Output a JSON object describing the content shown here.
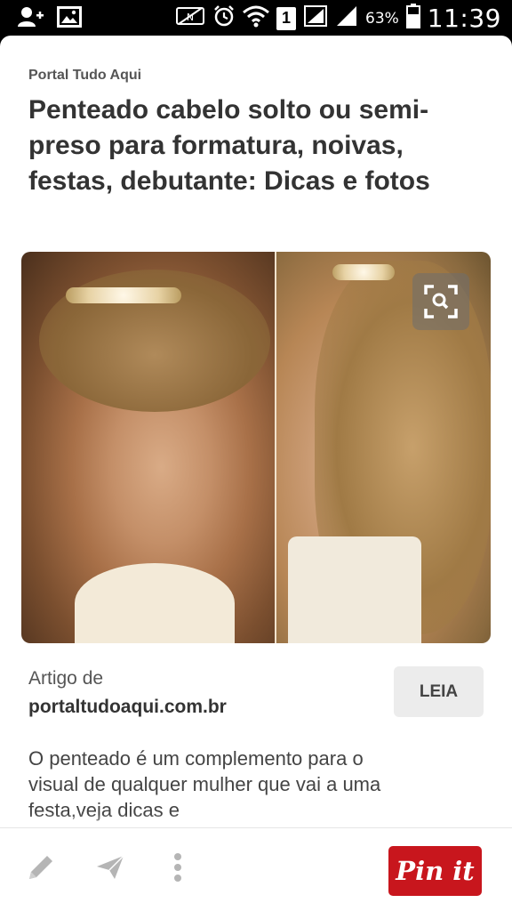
{
  "status_bar": {
    "battery_percent": "63%",
    "time": "11:39",
    "sim_slot": "1"
  },
  "pin": {
    "source": "Portal Tudo Aqui",
    "title": "Penteado cabelo solto ou semi-preso para formatura, noivas, festas, debutante: Dicas e fotos",
    "article_label": "Artigo de",
    "article_domain": "portaltudoaqui.com.br",
    "read_button": "LEIA",
    "description": "O penteado é um complemento para o visual de qualquer mulher que vai a uma festa,veja dicas e"
  },
  "actions": {
    "pin_it_label": "Pin it",
    "icons": [
      "edit-icon",
      "send-icon",
      "more-icon"
    ]
  },
  "colors": {
    "accent": "#c8161d",
    "background": "#ffffff",
    "text": "#333333"
  }
}
